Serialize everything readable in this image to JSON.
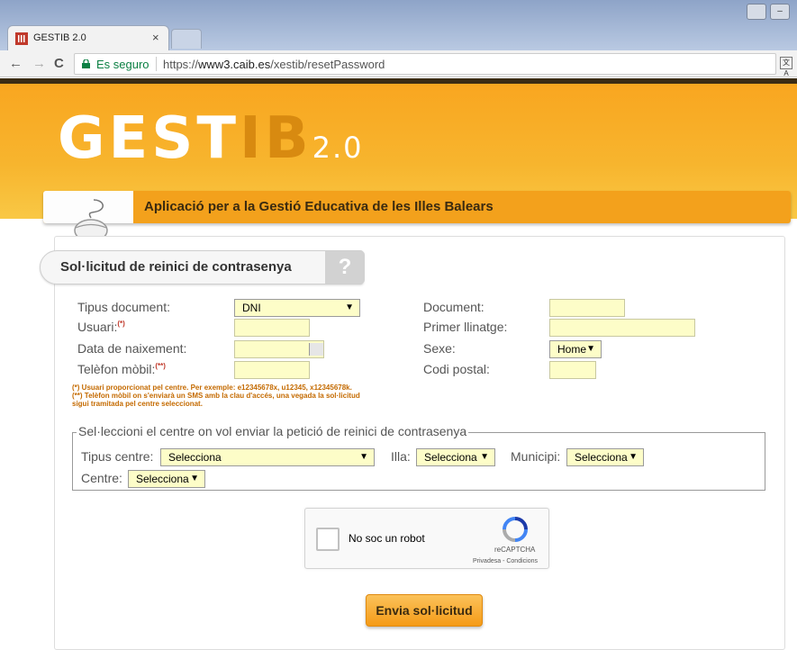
{
  "browser": {
    "tab_title": "GESTIB 2.0",
    "tab_close": "×",
    "secure_label": "Es seguro",
    "url_prefix": "https://",
    "url_host": "www3.caib.es",
    "url_path": "/xestib/resetPassword",
    "back_icon": "←",
    "forward_icon": "→",
    "reload_icon": "C"
  },
  "header": {
    "logo_main": "GEST",
    "logo_accent": "IB",
    "logo_version": "2.0",
    "subtitle": "Aplicació per a la Gestió Educativa de les Illes Balears"
  },
  "form": {
    "title": "Sol·licitud de reinici de contrasenya",
    "help": "?",
    "tipus_document_label": "Tipus document:",
    "tipus_document_value": "DNI",
    "usuari_label": "Usuari:",
    "usuari_mark": "(*)",
    "data_naixement_label": "Data de naixement:",
    "telefon_label": "Telèfon mòbil:",
    "telefon_mark": "(**)",
    "document_label": "Document:",
    "primer_llinatge_label": "Primer llinatge:",
    "sexe_label": "Sexe:",
    "sexe_value": "Home",
    "codi_postal_label": "Codi postal:",
    "note1": "(*) Usuari proporcionat pel centre. Per exemple: e12345678x, u12345, x12345678k.",
    "note2": "(**) Telèfon mòbil on s'enviarà un SMS amb la clau d'accés, una vegada la sol·licitud",
    "note3": "sigui tramitada pel centre seleccionat."
  },
  "centre": {
    "legend": "Sel·leccioni el centre on vol enviar la petició de reinici de contrasenya",
    "tipus_centre_label": "Tipus centre:",
    "tipus_centre_value": "Selecciona",
    "illa_label": "Illa:",
    "illa_value": "Selecciona",
    "municipi_label": "Municipi:",
    "municipi_value": "Selecciona",
    "centre_label": "Centre:",
    "centre_value": "Selecciona"
  },
  "captcha": {
    "label": "No soc un robot",
    "brand": "reCAPTCHA",
    "links": "Privadesa - Condicions"
  },
  "submit_label": "Envia sol·licitud",
  "caret": "▼"
}
